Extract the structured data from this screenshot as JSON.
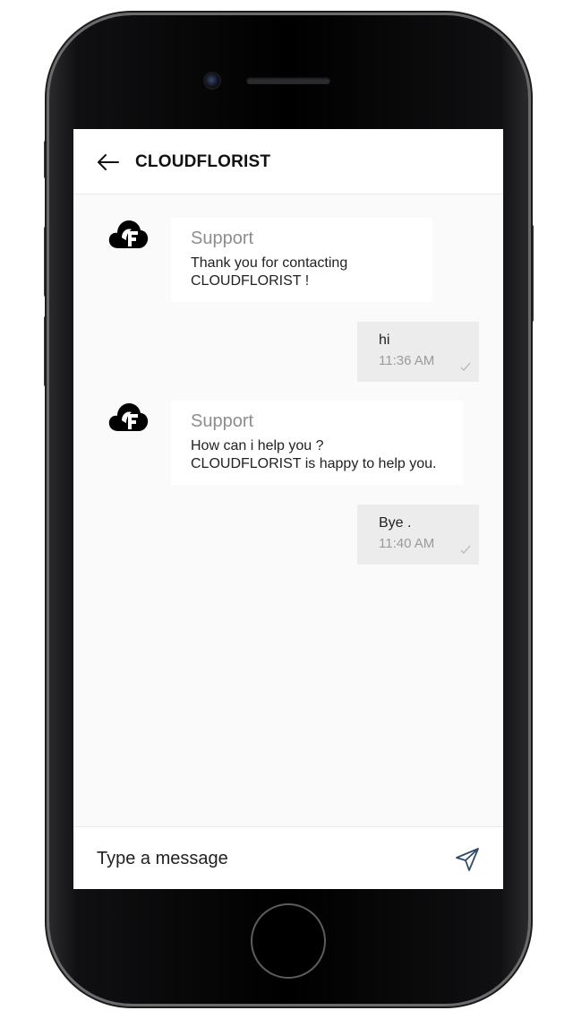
{
  "header": {
    "title": "CLOUDFLORIST",
    "back_icon": "arrow-left-icon"
  },
  "messages": [
    {
      "direction": "incoming",
      "sender": "Support",
      "text": "Thank you for contacting\nCLOUDFLORIST !",
      "avatar_icon": "cloudflorist-logo-icon"
    },
    {
      "direction": "outgoing",
      "text": "hi",
      "time": "11:36 AM",
      "status_icon": "check-icon"
    },
    {
      "direction": "incoming",
      "sender": "Support",
      "text": "How can i help you ?\nCLOUDFLORIST is happy to help you.",
      "avatar_icon": "cloudflorist-logo-icon"
    },
    {
      "direction": "outgoing",
      "text": "Bye .",
      "time": "11:40 AM",
      "status_icon": "check-icon"
    }
  ],
  "composer": {
    "placeholder": "Type a message",
    "value": "",
    "send_icon": "send-icon"
  },
  "colors": {
    "accent": "#2f4a6b",
    "header_bg": "#ffffff",
    "chat_bg": "#fafafa",
    "incoming_bubble": "#ffffff",
    "outgoing_bubble": "#ececec"
  }
}
